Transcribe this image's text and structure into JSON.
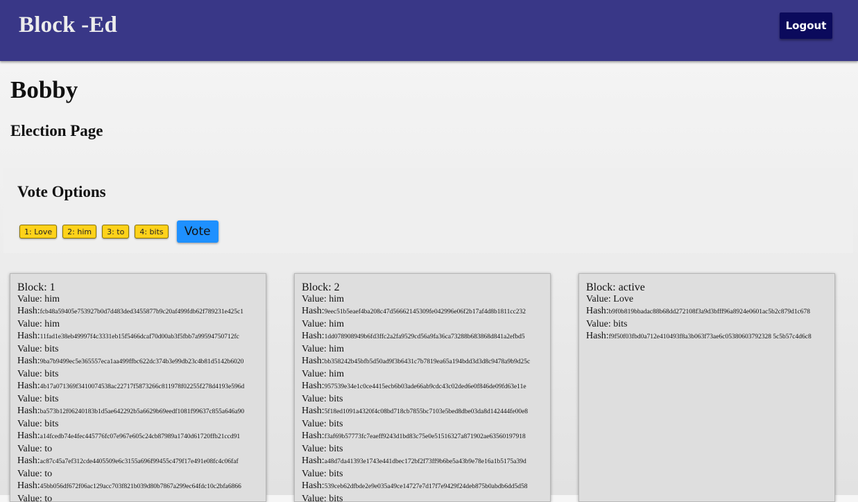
{
  "app": {
    "brand": "Block -Ed",
    "logout_label": "Logout"
  },
  "page": {
    "user_name": "Bobby",
    "subtitle": "Election Page"
  },
  "vote": {
    "heading": "Vote Options",
    "options": [
      "1: Love",
      "2: him",
      "3: to",
      "4: bits"
    ],
    "vote_label": "Vote",
    "colors": {
      "option": "#ffd21a",
      "vote_button": "#1e90ff"
    }
  },
  "labels": {
    "block_prefix": "Block: ",
    "value_prefix": "Value: ",
    "hash_prefix": "Hash:"
  },
  "blocks": [
    {
      "id": "1",
      "entries": [
        {
          "value": "him",
          "hash": "fcb48a59405e753927b0d7d483ded3455877b9c20af499fdb62f789231e425c1"
        },
        {
          "value": "him",
          "hash": "11fad1e38eb49997f4c3331eb15f5466dcaf70d00ab3f5fbb7a99594750712fc"
        },
        {
          "value": "bits",
          "hash": "9ba7b9499ec5e365557eca1aa499ffbc622dc374b3e99db23c4b81d5142b6020"
        },
        {
          "value": "bits",
          "hash": "4b17a071369f3410074538ac22717f5873266c811978f02255f278d4193e596d"
        },
        {
          "value": "bits",
          "hash": "ba573b12f06240183b1d5ae642292b5a6629b69eedf1081f99637c855a646a90"
        },
        {
          "value": "bits",
          "hash": "a14fcedb74e4fec445776fc07e967e605c24cb87989a1740d61720ffb21ccd91"
        },
        {
          "value": "to",
          "hash": "ac87c45a7ef312cde4405509e6c3155a696f99455c479f17e491e08fc4c06faf"
        },
        {
          "value": "to",
          "hash": "45bb056df672f06ac129acc703f821b039d80b7867a299ec64fdc10c2bfa6866"
        },
        {
          "value": "to",
          "hash": ""
        }
      ]
    },
    {
      "id": "2",
      "entries": [
        {
          "value": "him",
          "hash": "9eec51b5eaef4ba208c47d56662145309fe042996e06f2b17af4d8b1811cc232"
        },
        {
          "value": "him",
          "hash": "1dd078908949b6fd3ffc2a2fa9529cd56a9fa36ca73288b683868d841a2efbd5"
        },
        {
          "value": "him",
          "hash": "bb358242b45bfb5d50ad9f3b6431c7b7819ea65a194bdd3d3d8c9478a9b9d25c"
        },
        {
          "value": "him",
          "hash": "957539e34e1c0ce4415ecb6b03ade66ab9cdc43c02ded6e0f846de09fd63e11e"
        },
        {
          "value": "bits",
          "hash": "5f18ed1091a4320f4c08bd718cb7855bc7103e5bed8dbe03da8d142444fe00e8"
        },
        {
          "value": "bits",
          "hash": "f3af69b57773fc7eaeff9243d1bd83c75e0e51516327a871902ae63560197918"
        },
        {
          "value": "bits",
          "hash": "a48d7da41393e1743e441dbec172bf2f73ff9b6be5a43b9e78e16a1b5175a39d"
        },
        {
          "value": "bits",
          "hash": "539ceb62dfbde2e9e035a49ce14727e7d17f7e9429f24deb875b0abdb6dd5d58"
        },
        {
          "value": "bits",
          "hash": ""
        }
      ]
    },
    {
      "id": "active",
      "entries": [
        {
          "value": "Love",
          "hash": "b9f0b819bbadac88b68dd272108f3a9d3bfff96a8924e0601ac5b2c879d1c678"
        },
        {
          "value": "bits",
          "hash": "f9f50f03fbd0a712e410493f8a3b063f73ae6c05380603792328 5c5b57c4d6c8"
        }
      ]
    }
  ]
}
